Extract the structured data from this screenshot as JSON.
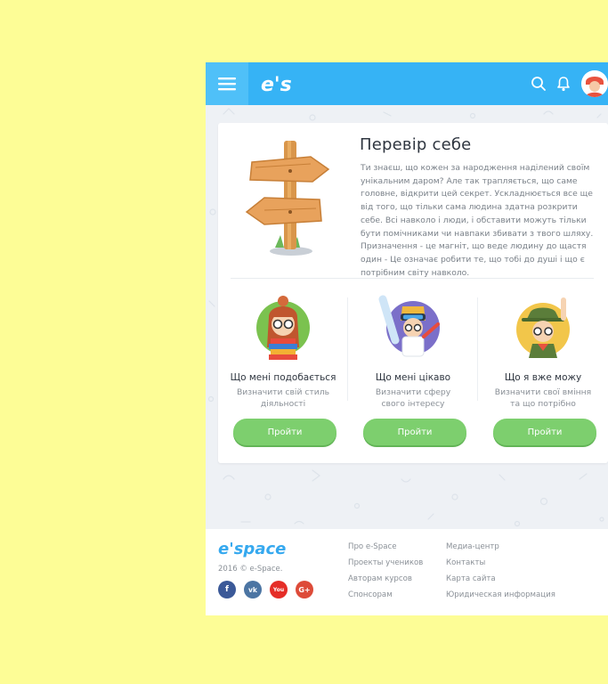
{
  "header": {
    "logo_text": "e's",
    "icons": [
      "menu-icon",
      "search-icon",
      "bell-icon",
      "avatar"
    ]
  },
  "card": {
    "title": "Перевір себе",
    "text": "Ти знаєш, що кожен за народження наділений своїм унікальним даром? Але так трапляється, що саме головне, відкрити цей секрет. Ускладнюється все ще від того, що тільки сама людина здатна розкрити себе. Всі навколо і люди, і обставити можуть тільки бути помічниками чи навпаки збивати з твого шляху. Призначення - це магніт, що веде людину до щастя один - Це означає робити те, що тобі до душі і що є потрібним світу навколо."
  },
  "tests": [
    {
      "title": "Що мені подобається",
      "subtitle": "Визначити свій стиль діяльності",
      "button": "Пройти"
    },
    {
      "title": "Що мені цікаво",
      "subtitle": "Визначити сферу свого інтересу",
      "button": "Пройти"
    },
    {
      "title": "Що я вже можу",
      "subtitle": "Визначити свої вміння та що потрібно",
      "button": "Пройти"
    }
  ],
  "footer": {
    "logo_text": "e'space",
    "copyright": "2016 © e-Space.",
    "social": [
      {
        "name": "facebook",
        "label": "f",
        "color": "#3b5998"
      },
      {
        "name": "vk",
        "label": "vk",
        "color": "#4c75a3"
      },
      {
        "name": "youtube",
        "label": "You",
        "color": "#e52d27"
      },
      {
        "name": "google-plus",
        "label": "G+",
        "color": "#dd4b39"
      }
    ],
    "links_col1": [
      "Про e-Space",
      "Проекты учеников",
      "Авторам курсов",
      "Спонсорам"
    ],
    "links_col2": [
      "Медиа-центр",
      "Контакты",
      "Карта сайта",
      "Юридическая информация"
    ]
  },
  "colors": {
    "background": "#fdfd96",
    "header": "#36b3f5",
    "accent_green": "#7dcf6e",
    "footer_logo": "#36a9ef"
  }
}
